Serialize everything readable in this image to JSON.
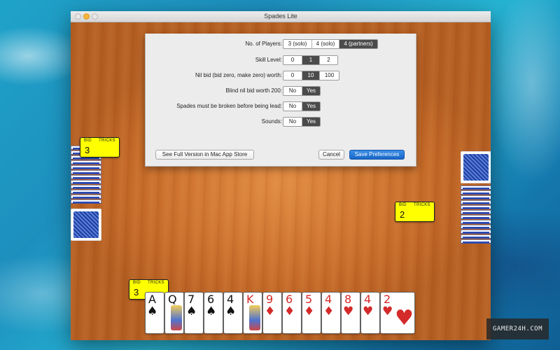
{
  "window": {
    "title": "Spades Lite"
  },
  "preferences": {
    "players": {
      "label": "No. of Players:",
      "options": [
        "3 (solo)",
        "4 (solo)",
        "4 (partners)"
      ],
      "selected": "4 (partners)"
    },
    "skill": {
      "label": "Skill Level:",
      "options": [
        "0",
        "1",
        "2"
      ],
      "selected": "1"
    },
    "nil": {
      "label": "Nil bid (bid zero, make zero) worth:",
      "options": [
        "0",
        "10",
        "100"
      ],
      "selected": "10"
    },
    "blind_nil": {
      "label": "Blind nil bid worth 200:",
      "options": [
        "No",
        "Yes"
      ],
      "selected": "Yes"
    },
    "spades_broken": {
      "label": "Spades must be broken before being lead:",
      "options": [
        "No",
        "Yes"
      ],
      "selected": "Yes"
    },
    "sounds": {
      "label": "Sounds:",
      "options": [
        "No",
        "Yes"
      ],
      "selected": "Yes"
    },
    "full_version_label": "See Full Version in Mac App Store",
    "cancel_label": "Cancel",
    "save_label": "Save Preferences"
  },
  "bids": {
    "header_bid": "BID",
    "header_tricks": "TRICKS",
    "west": "3",
    "east": "2",
    "south": "3"
  },
  "hand": [
    {
      "rank": "A",
      "suit": "♠",
      "color": "blk"
    },
    {
      "rank": "Q",
      "suit": "♠",
      "color": "blk"
    },
    {
      "rank": "7",
      "suit": "♠",
      "color": "blk"
    },
    {
      "rank": "6",
      "suit": "♠",
      "color": "blk"
    },
    {
      "rank": "4",
      "suit": "♠",
      "color": "blk"
    },
    {
      "rank": "K",
      "suit": "♦",
      "color": "red"
    },
    {
      "rank": "9",
      "suit": "♦",
      "color": "red"
    },
    {
      "rank": "6",
      "suit": "♦",
      "color": "red"
    },
    {
      "rank": "5",
      "suit": "♦",
      "color": "red"
    },
    {
      "rank": "4",
      "suit": "♦",
      "color": "red"
    },
    {
      "rank": "8",
      "suit": "♥",
      "color": "red"
    },
    {
      "rank": "4",
      "suit": "♥",
      "color": "red"
    },
    {
      "rank": "2",
      "suit": "♥",
      "color": "red"
    }
  ],
  "watermark": "GAMER24H.COM"
}
